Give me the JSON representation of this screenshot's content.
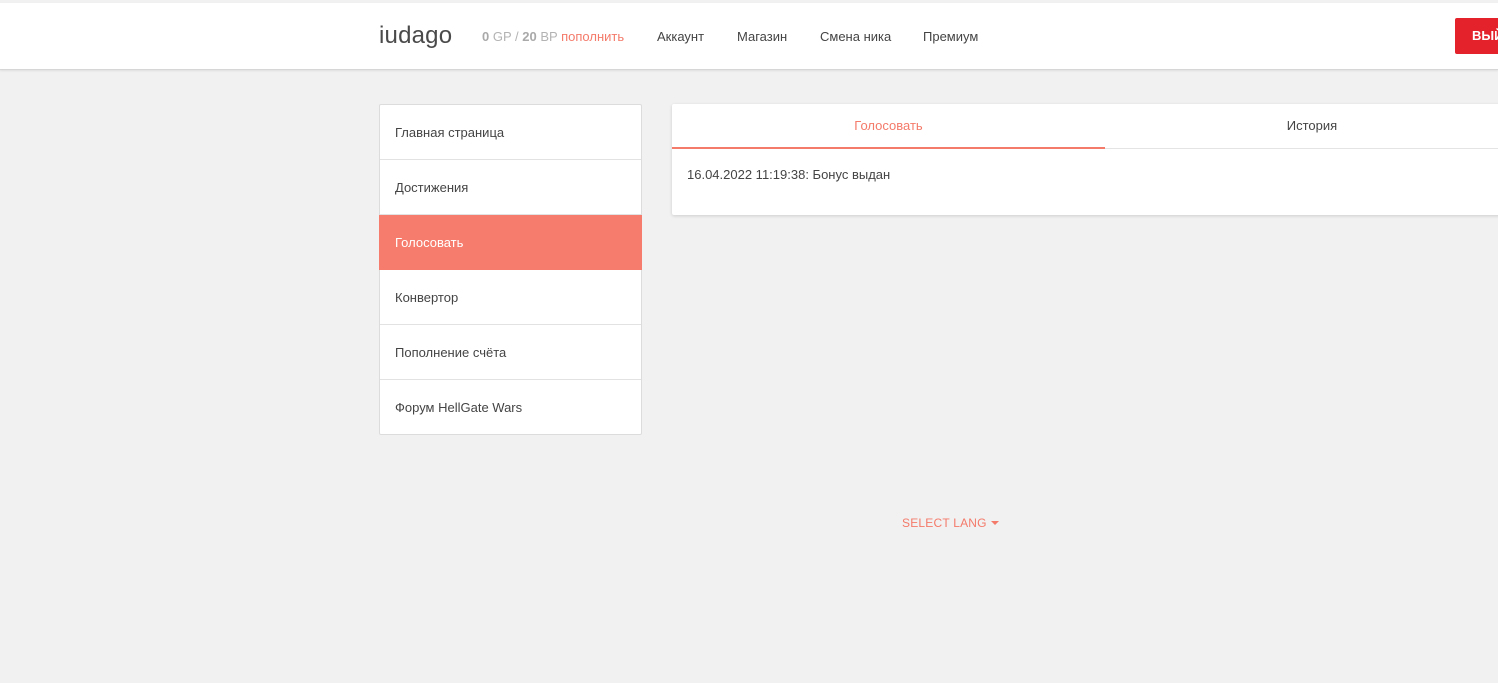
{
  "header": {
    "brand": "iudago",
    "balance": {
      "gp_value": "0",
      "gp_unit": "GP",
      "separator": "/",
      "bp_value": "20",
      "bp_unit": "BP",
      "topup_label": "пополнить"
    },
    "nav": [
      {
        "label": "Аккаунт"
      },
      {
        "label": "Магазин"
      },
      {
        "label": "Смена ника"
      },
      {
        "label": "Премиум"
      }
    ],
    "logout_label": "ВЫЙ"
  },
  "sidebar": {
    "items": [
      {
        "label": "Главная страница"
      },
      {
        "label": "Достижения"
      },
      {
        "label": "Голосовать",
        "active": true
      },
      {
        "label": "Конвертор"
      },
      {
        "label": "Пополнение счёта"
      },
      {
        "label": "Форум HellGate Wars"
      }
    ]
  },
  "panel": {
    "tabs": [
      {
        "label": "Голосовать",
        "active": true
      },
      {
        "label": "История"
      }
    ],
    "log": "16.04.2022 11:19:38: Бонус выдан"
  },
  "footer": {
    "lang_label": "SELECT LANG"
  },
  "colors": {
    "accent": "#f47a6a",
    "active_bg": "#f67c6d",
    "logout_bg": "#e3222b",
    "page_bg": "#f1f1f1"
  }
}
